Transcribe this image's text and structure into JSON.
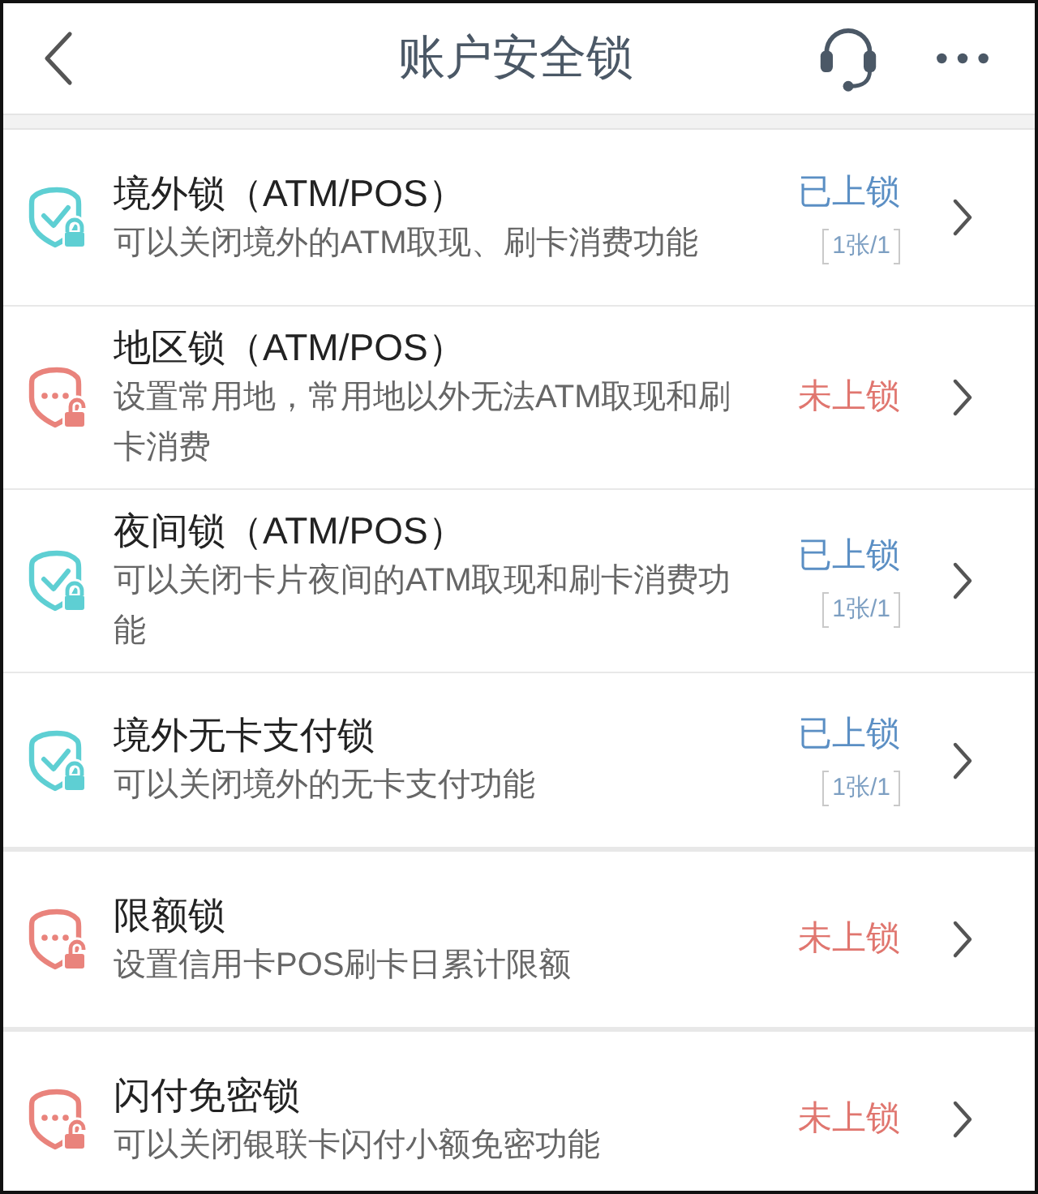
{
  "header": {
    "title": "账户安全锁"
  },
  "groups": [
    {
      "items": [
        {
          "title": "境外锁（ATM/POS）",
          "description": "可以关闭境外的ATM取现、刷卡消费功能",
          "locked": true,
          "status": "已上锁",
          "cards": "1张/1"
        },
        {
          "title": "地区锁（ATM/POS）",
          "description": "设置常用地，常用地以外无法ATM取现和刷卡消费",
          "locked": false,
          "status": "未上锁"
        },
        {
          "title": "夜间锁（ATM/POS）",
          "description": "可以关闭卡片夜间的ATM取现和刷卡消费功能",
          "locked": true,
          "status": "已上锁",
          "cards": "1张/1"
        },
        {
          "title": "境外无卡支付锁",
          "description": "可以关闭境外的无卡支付功能",
          "locked": true,
          "status": "已上锁",
          "cards": "1张/1"
        }
      ]
    },
    {
      "items": [
        {
          "title": "限额锁",
          "description": "设置信用卡POS刷卡日累计限额",
          "locked": false,
          "status": "未上锁"
        }
      ]
    },
    {
      "items": [
        {
          "title": "闪付免密锁",
          "description": "可以关闭银联卡闪付小额免密功能",
          "locked": false,
          "status": "未上锁"
        }
      ]
    }
  ]
}
